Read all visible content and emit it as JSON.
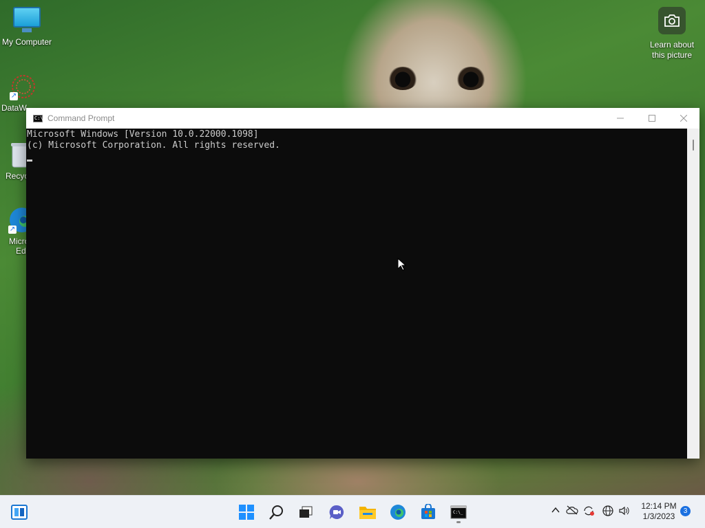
{
  "desktop": {
    "icons": [
      {
        "label": "My Computer",
        "icon": "monitor-icon"
      },
      {
        "label": "DataW",
        "icon": "datawrapper-icon"
      },
      {
        "label": "Recyc",
        "icon": "recycle-bin-icon"
      },
      {
        "label": "Micro Ed",
        "label_line1": "Micro",
        "label_line2": "Ed",
        "icon": "edge-icon"
      }
    ],
    "learn_about": {
      "line1": "Learn about",
      "line2": "this picture",
      "icon": "camera-icon"
    }
  },
  "window": {
    "title": "Command Prompt",
    "controls": {
      "minimize": "minimize-icon",
      "maximize": "maximize-icon",
      "close": "close-icon"
    },
    "console_lines": [
      "Microsoft Windows [Version 10.0.22000.1098]",
      "(c) Microsoft Corporation. All rights reserved."
    ]
  },
  "taskbar": {
    "pinned": [
      "widgets-icon",
      "start-icon",
      "search-icon",
      "task-view-icon",
      "chat-icon",
      "file-explorer-icon",
      "edge-icon",
      "store-icon",
      "terminal-icon"
    ],
    "tray": [
      "chevron-up-icon",
      "onedrive-icon",
      "sync-icon",
      "network-icon",
      "volume-icon"
    ],
    "time": "12:14 PM",
    "date": "1/3/2023",
    "notifications": "3"
  },
  "colors": {
    "console_bg": "#0c0c0c",
    "console_fg": "#cccccc",
    "taskbar_bg": "#eef1f6",
    "accent": "#1a6fe0"
  }
}
